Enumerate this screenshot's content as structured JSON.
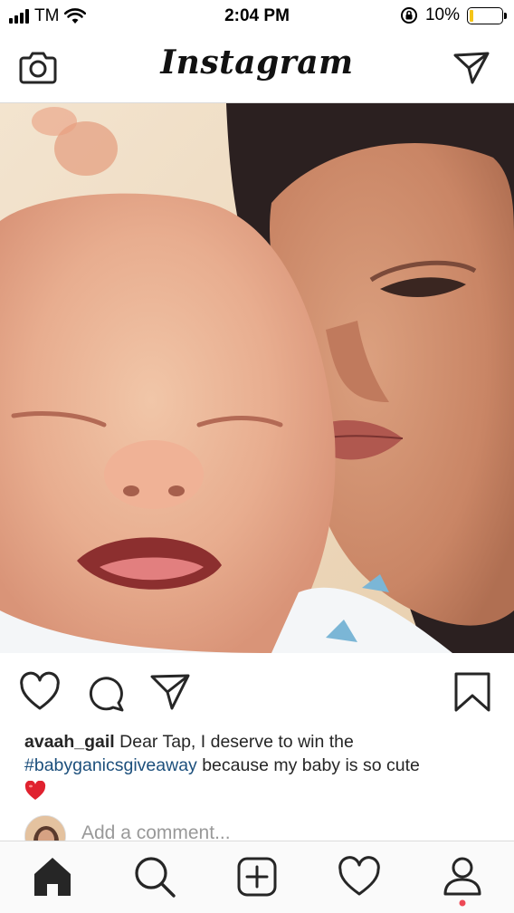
{
  "status_bar": {
    "carrier": "TM",
    "time": "2:04 PM",
    "battery_percent": "10%",
    "battery_level": 0.1,
    "icons": [
      "signal-icon",
      "wifi-icon",
      "orientation-lock-icon",
      "battery-icon"
    ]
  },
  "header": {
    "logo": "Instagram",
    "left_icon": "camera-icon",
    "right_icon": "direct-message-icon"
  },
  "post": {
    "photo": "photo of a crying baby next to a woman",
    "actions": [
      "like-icon",
      "comment-icon",
      "share-icon",
      "save-icon"
    ],
    "caption": {
      "username": "avaah_gail",
      "text_before": " Dear Tap, I deserve to win the ",
      "hashtag": "#babyganicsgiveaway",
      "text_after": " because my baby is so cute",
      "emoji": "red-heart-emoji"
    },
    "comment_placeholder": "Add a comment..."
  },
  "tab_bar": {
    "items": [
      "home-icon",
      "search-icon",
      "new-post-icon",
      "activity-icon",
      "profile-icon"
    ],
    "active": "home-icon",
    "notification_color": "#ed4956"
  }
}
